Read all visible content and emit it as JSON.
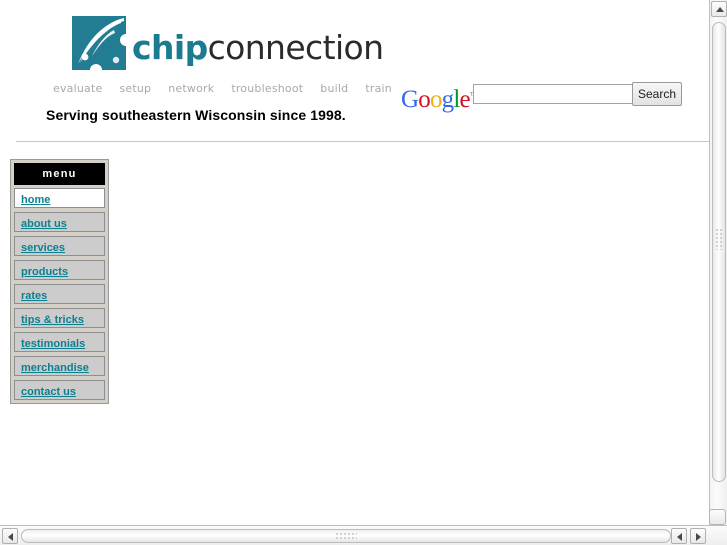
{
  "site": {
    "brand_chip": "chip",
    "brand_connection": "connection",
    "logo_icon": "chipconnection-puzzle-swoosh-logo",
    "tagline": "Serving southeastern Wisconsin since 1998.",
    "brand_color": "#1b7b91",
    "link_color": "#0c8090"
  },
  "subnav": {
    "items": [
      {
        "label": "evaluate"
      },
      {
        "label": "setup"
      },
      {
        "label": "network"
      },
      {
        "label": "troubleshoot"
      },
      {
        "label": "build"
      },
      {
        "label": "train"
      }
    ]
  },
  "search": {
    "provider_logo": "google-logo",
    "provider_letters": [
      {
        "char": "G",
        "color": "#3369e8"
      },
      {
        "char": "o",
        "color": "#d50f25"
      },
      {
        "char": "o",
        "color": "#eeb211"
      },
      {
        "char": "g",
        "color": "#3369e8"
      },
      {
        "char": "l",
        "color": "#009925"
      },
      {
        "char": "e",
        "color": "#d50f25"
      }
    ],
    "trademark": "™",
    "input_value": "",
    "placeholder": "",
    "button_label": "Search"
  },
  "menu": {
    "title": "menu",
    "items": [
      {
        "label": "home",
        "current": true
      },
      {
        "label": "about us",
        "current": false
      },
      {
        "label": "services",
        "current": false
      },
      {
        "label": "products",
        "current": false
      },
      {
        "label": "rates",
        "current": false
      },
      {
        "label": "tips & tricks",
        "current": false
      },
      {
        "label": "testimonials",
        "current": false
      },
      {
        "label": "merchandise",
        "current": false
      },
      {
        "label": "contact us",
        "current": false
      }
    ]
  },
  "content": {
    "body_text": ""
  },
  "scrollbars": {
    "vertical": {
      "up_arrow": "▲",
      "grip": "scroll-grip"
    },
    "horizontal": {
      "left_arrow": "◀",
      "right_arrow": "▶",
      "grip": "scroll-grip"
    },
    "resize_corner": "resize-grip"
  }
}
